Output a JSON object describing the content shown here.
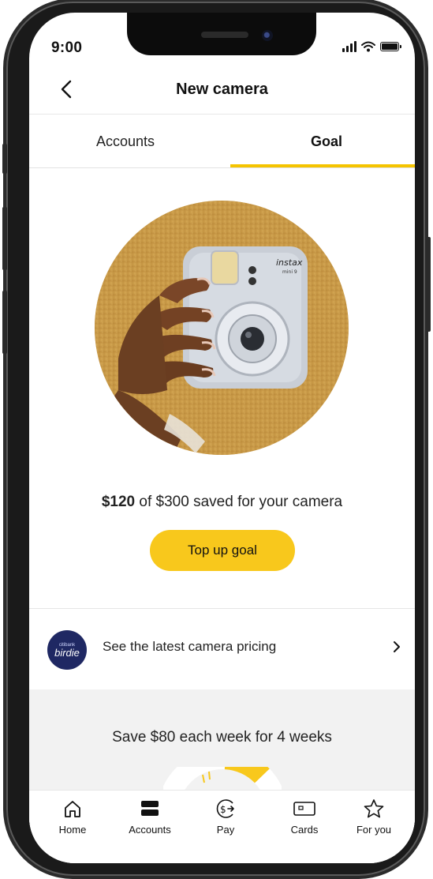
{
  "status_bar": {
    "time": "9:00"
  },
  "header": {
    "title": "New camera"
  },
  "tabs": [
    {
      "label": "Accounts",
      "active": false
    },
    {
      "label": "Goal",
      "active": true
    }
  ],
  "goal": {
    "saved_amount": "$120",
    "saved_rest": " of $300 saved for your camera",
    "cta_label": "Top up goal",
    "progress_fraction": 0.4
  },
  "promo": {
    "logo_small": "citibank",
    "logo_word": "birdie",
    "label": "See the latest camera pricing"
  },
  "plan": {
    "text": "Save $80 each week for 4 weeks"
  },
  "bottom_nav": [
    {
      "label": "Home",
      "icon": "home-icon"
    },
    {
      "label": "Accounts",
      "icon": "accounts-icon"
    },
    {
      "label": "Pay",
      "icon": "pay-icon"
    },
    {
      "label": "Cards",
      "icon": "cards-icon"
    },
    {
      "label": "For you",
      "icon": "star-icon"
    }
  ],
  "colors": {
    "accent": "#f8c81c",
    "tab_underline": "#f5c400",
    "birdie_blue": "#1f2863",
    "panel_gray": "#f2f2f2"
  }
}
